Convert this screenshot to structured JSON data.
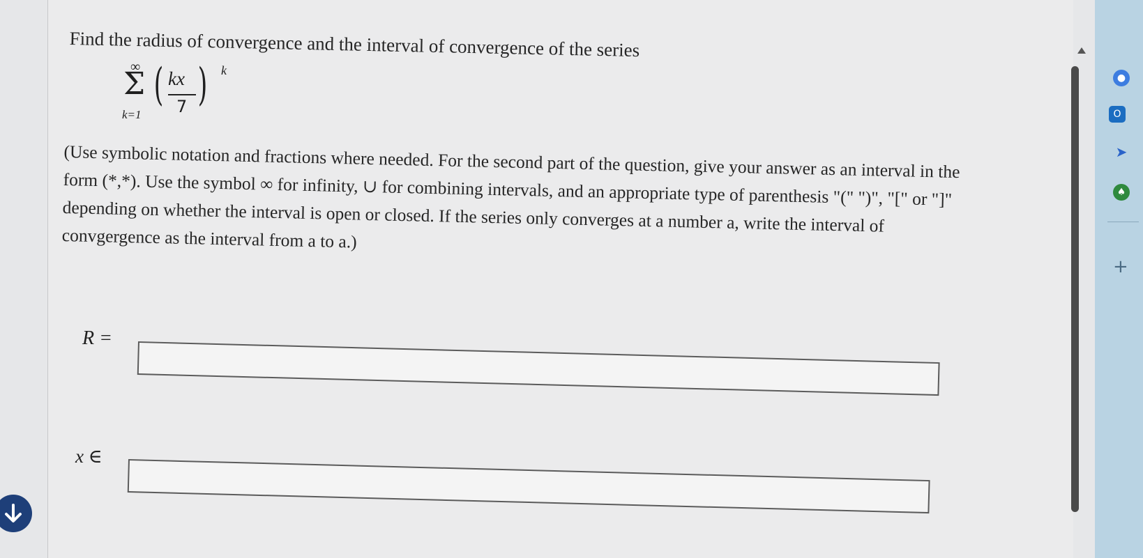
{
  "question": {
    "title": "Find the radius of convergence and the interval of convergence of the series",
    "series": {
      "upper_limit": "∞",
      "sigma": "Σ",
      "lower_limit": "k=1",
      "numerator": "kx",
      "denominator": "7",
      "exponent": "k"
    },
    "instructions": [
      "(Use symbolic notation and fractions where needed. For the second part of the question, give your answer as an interval in the",
      "form (*,*). Use the symbol ∞ for infinity, ∪ for combining intervals, and an appropriate type of parenthesis \"(\" \")\", \"[\" or \"]\"",
      "depending on whether the interval is open or closed. If the series only converges at a number a, write the interval of",
      "convgergence as the interval from a to a.)"
    ]
  },
  "answers": {
    "radius_label": "R =",
    "radius_value": "",
    "interval_label": "x ∈",
    "interval_value": ""
  },
  "sidebar": {
    "plus_label": "+"
  }
}
